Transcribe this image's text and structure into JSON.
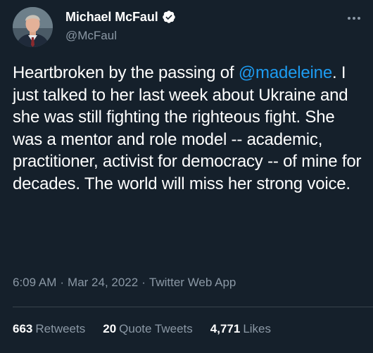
{
  "author": {
    "display_name": "Michael McFaul",
    "handle": "@McFaul",
    "verified": true,
    "avatar_icon": "person-photo-icon"
  },
  "tweet": {
    "text_before_mention": "Heartbroken by the passing of ",
    "mention": "@madeleine",
    "text_after_mention": ". I just talked to her last week about Ukraine and she was still fighting the righteous fight. She was a mentor and role model -- academic, practitioner, activist for democracy -- of mine for decades. The world will miss her strong voice."
  },
  "meta": {
    "time": "6:09 AM",
    "separator": "·",
    "date": "Mar 24, 2022",
    "source": "Twitter Web App"
  },
  "stats": {
    "retweets_count": "663",
    "retweets_label": "Retweets",
    "quotes_count": "20",
    "quotes_label": "Quote Tweets",
    "likes_count": "4,771",
    "likes_label": "Likes"
  },
  "colors": {
    "background": "#15202b",
    "text_primary": "#ffffff",
    "text_secondary": "#8b98a5",
    "link": "#1d9bf0",
    "verified_badge": "#ffffff",
    "divider": "#38444d"
  },
  "icons": {
    "more": "more-horizontal-icon",
    "verified": "verified-badge-icon"
  }
}
